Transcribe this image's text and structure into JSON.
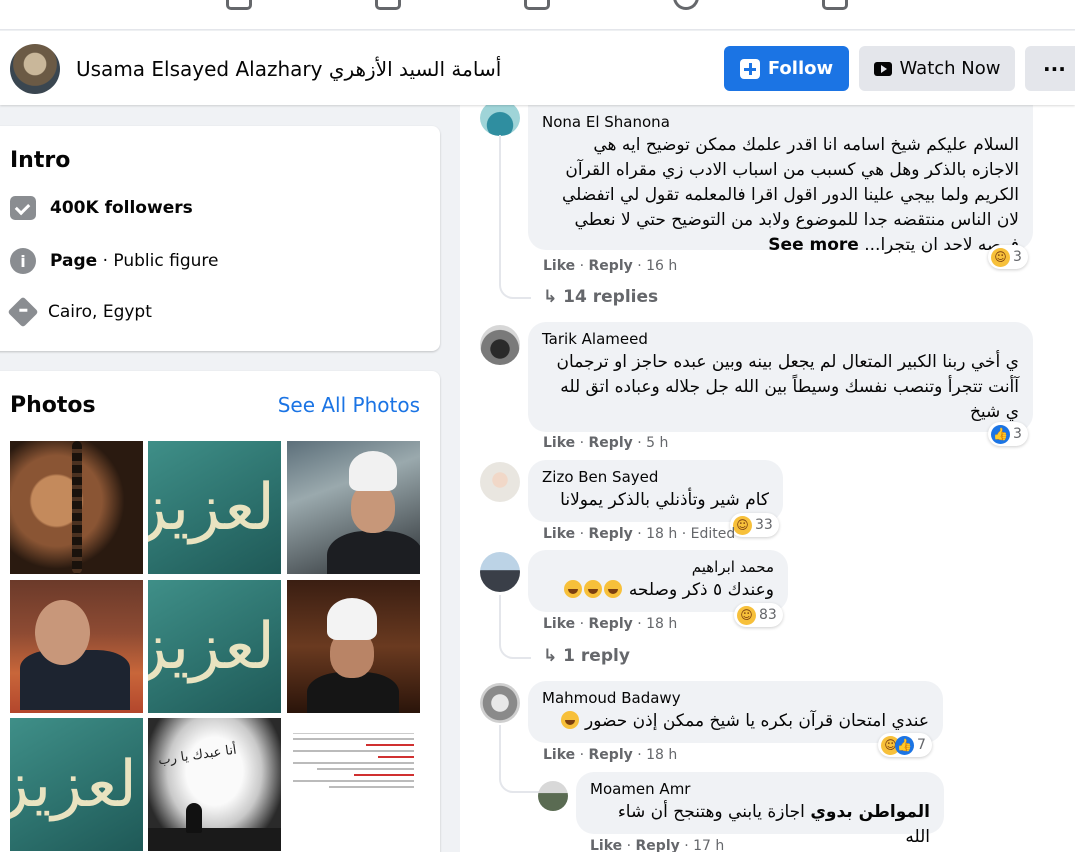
{
  "profile": {
    "name": "Usama Elsayed Alazhary أسامة السيد الأزهري",
    "follow_label": "Follow",
    "watch_label": "Watch Now",
    "more_label": "···"
  },
  "intro": {
    "title": "Intro",
    "followers": "400K followers",
    "page_label": "Page",
    "page_category": " · Public figure",
    "location": "Cairo, Egypt"
  },
  "photos": {
    "title": "Photos",
    "see_all": "See All Photos",
    "calligraphy": "العزيز",
    "caption": "أنا عبدك يا رب"
  },
  "comments": [
    {
      "name": "Nona El Shanona",
      "text": "السلام عليكم شيخ اسامه انا اقدر علمك ممكن توضيح ايه هي الاجازه بالذكر وهل هي كسبب من اسباب الادب زي مقراه القرآن الكريم ولما بيجي علينا الدور اقول اقرا فالمعلمه تقول لي اتفضلي لان الناس منتقضه جدا للموضوع ولابد من التوضيح حتي لا نعطي فرصه لاحد ان يتجرا...",
      "see_more": "See more",
      "like": "Like",
      "reply": "Reply",
      "time": "16 h",
      "reactions": "3",
      "replies": "14 replies"
    },
    {
      "name": "Tarik Alameed",
      "text": "ي أخي ربنا الكبير المتعال لم يجعل بينه وبين عبده حاجز او ترجمان آأنت تتجرأ وتنصب نفسك وسيطاً بين الله جل جلاله وعباده اتق لله ي شيخ",
      "like": "Like",
      "reply": "Reply",
      "time": "5 h",
      "reactions": "3"
    },
    {
      "name": "Zizo Ben Sayed",
      "text": "كام شير وتأذنلي بالذكر يمولانا",
      "like": "Like",
      "reply": "Reply",
      "time": "18 h",
      "edited": "Edited",
      "reactions": "33"
    },
    {
      "name": "محمد ابراهيم",
      "text": "وعندك ٥ ذكر وصلحه",
      "like": "Like",
      "reply": "Reply",
      "time": "18 h",
      "reactions": "83",
      "replies": "1 reply"
    },
    {
      "name": "Mahmoud Badawy",
      "text": "عندي امتحان قرآن بكره يا شيخ ممكن إذن حضور",
      "like": "Like",
      "reply": "Reply",
      "time": "18 h",
      "reactions": "7"
    },
    {
      "name": "Moamen Amr",
      "text_bold": "المواطن بدوي",
      "text": " اجازة يابني وهتنجح أن شاء الله",
      "like": "Like",
      "reply": "Reply",
      "time": "17 h"
    }
  ]
}
